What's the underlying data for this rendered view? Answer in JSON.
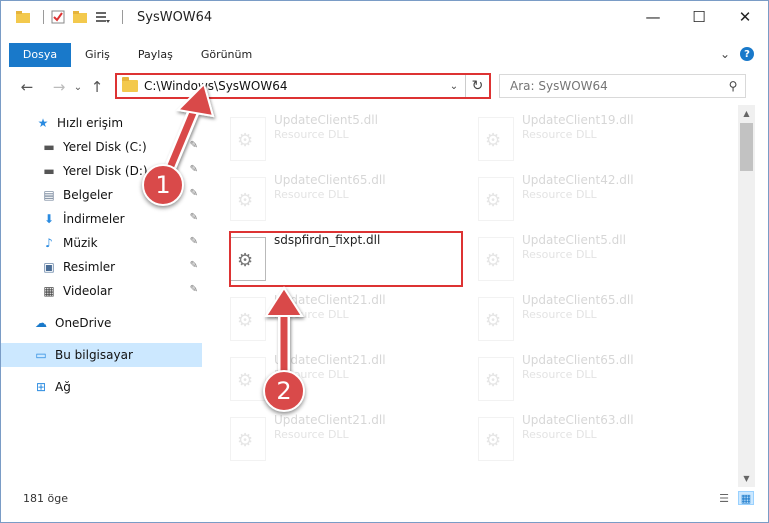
{
  "window": {
    "title": "SysWOW64",
    "controls": {
      "minimize": "—",
      "maximize": "☐",
      "close": "✕"
    }
  },
  "ribbon": {
    "tabs": [
      "Dosya",
      "Giriş",
      "Paylaş",
      "Görünüm"
    ],
    "expand_icon": "⌄",
    "help_label": "?"
  },
  "nav": {
    "back": "←",
    "forward": "→",
    "recent": "⌄",
    "up": "↑",
    "address": "C:\\Windows\\SysWOW64",
    "address_dropdown": "⌄",
    "refresh": "↻",
    "search_placeholder": "Ara: SysWOW64",
    "search_icon_glyph": "⚲"
  },
  "sidebar": {
    "items": [
      {
        "label": "Hızlı erişim",
        "icon": "★",
        "pinned": false,
        "selected": false
      },
      {
        "label": "Yerel Disk (C:)",
        "icon": "▬",
        "pinned": true,
        "selected": false
      },
      {
        "label": "Yerel Disk (D:)",
        "icon": "▬",
        "pinned": true,
        "selected": false
      },
      {
        "label": "Belgeler",
        "icon": "▤",
        "pinned": true,
        "selected": false
      },
      {
        "label": "İndirmeler",
        "icon": "⬇",
        "pinned": true,
        "selected": false
      },
      {
        "label": "Müzik",
        "icon": "♪",
        "pinned": true,
        "selected": false
      },
      {
        "label": "Resimler",
        "icon": "▣",
        "pinned": true,
        "selected": false
      },
      {
        "label": "Videolar",
        "icon": "▦",
        "pinned": true,
        "selected": false
      },
      {
        "label": "OneDrive",
        "icon": "☁",
        "pinned": false,
        "selected": false
      },
      {
        "label": "Bu bilgisayar",
        "icon": "▭",
        "pinned": false,
        "selected": true
      },
      {
        "label": "Ağ",
        "icon": "⊞",
        "pinned": false,
        "selected": false
      }
    ],
    "pin_glyph": "✎"
  },
  "files": {
    "left_column": [
      {
        "name": "UpdateClient5.dll",
        "type": "Resource DLL",
        "faded": true
      },
      {
        "name": "UpdateClient65.dll",
        "type": "Resource DLL",
        "faded": true
      },
      {
        "name": "sdspfirdn_fixpt.dll",
        "type": "",
        "faded": false
      },
      {
        "name": "UpdateClient21.dll",
        "type": "Resource DLL",
        "faded": true
      },
      {
        "name": "UpdateClient21.dll",
        "type": "Resource DLL",
        "faded": true
      },
      {
        "name": "UpdateClient21.dll",
        "type": "Resource DLL",
        "faded": true
      }
    ],
    "right_column": [
      {
        "name": "UpdateClient19.dll",
        "type": "Resource DLL",
        "faded": true
      },
      {
        "name": "UpdateClient42.dll",
        "type": "Resource DLL",
        "faded": true
      },
      {
        "name": "UpdateClient5.dll",
        "type": "Resource DLL",
        "faded": true
      },
      {
        "name": "UpdateClient65.dll",
        "type": "Resource DLL",
        "faded": true
      },
      {
        "name": "UpdateClient65.dll",
        "type": "Resource DLL",
        "faded": true
      },
      {
        "name": "UpdateClient63.dll",
        "type": "Resource DLL",
        "faded": true
      }
    ]
  },
  "status": {
    "count": "181 öge",
    "views": [
      "details-view",
      "large-icons-view"
    ]
  },
  "annotations": {
    "step1": "1",
    "step2": "2",
    "color": "#d94a4a"
  }
}
